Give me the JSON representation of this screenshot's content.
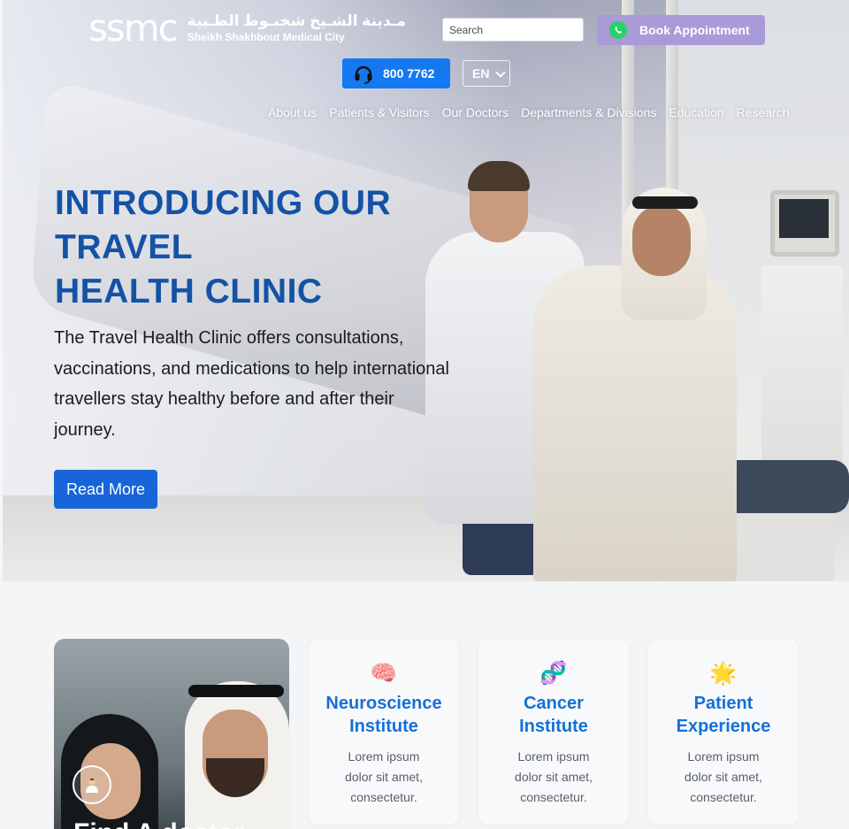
{
  "header": {
    "logo_mark": "ssmc",
    "logo_arabic": "مـدينة الشـيخ شخبـوط الطـبية",
    "logo_english": "Sheikh Shakhbout Medical City",
    "search_placeholder": "Search",
    "book_label": "Book Appointment",
    "phone_label": "800 7762",
    "language": "EN"
  },
  "nav": {
    "items": [
      "About us",
      "Patients & Visitors",
      "Our Doctors",
      "Departments & Divisions",
      "Education",
      "Research"
    ]
  },
  "hero": {
    "title_line1": "INTRODUCING OUR",
    "title_line2": "TRAVEL",
    "title_line3": "HEALTH CLINIC",
    "description": "The Travel Health Clinic offers consultations, vaccinations, and medications to help international travellers stay healthy before and after their journey.",
    "cta_label": "Read More"
  },
  "find_card": {
    "title": "Find A doctor",
    "icon": "doctor-icon"
  },
  "services": [
    {
      "icon": "brain-icon",
      "glyph": "🧠",
      "title_line1": "Neuroscience",
      "title_line2": "Institute",
      "text": "Lorem ipsum dolor sit amet, consectetur."
    },
    {
      "icon": "dna-icon",
      "glyph": "🧬",
      "title_line1": "Cancer",
      "title_line2": "Institute",
      "text": "Lorem ipsum dolor sit amet, consectetur."
    },
    {
      "icon": "star-icon",
      "glyph": "🌟",
      "title_line1": "Patient",
      "title_line2": "Experience",
      "text": "Lorem ipsum dolor sit amet, consectetur."
    }
  ],
  "colors": {
    "hero_title": "#1452a6",
    "primary_button": "#1765d8",
    "phone_button": "#1478f0",
    "book_button": "#a99ad8",
    "service_title": "#1470d8"
  }
}
